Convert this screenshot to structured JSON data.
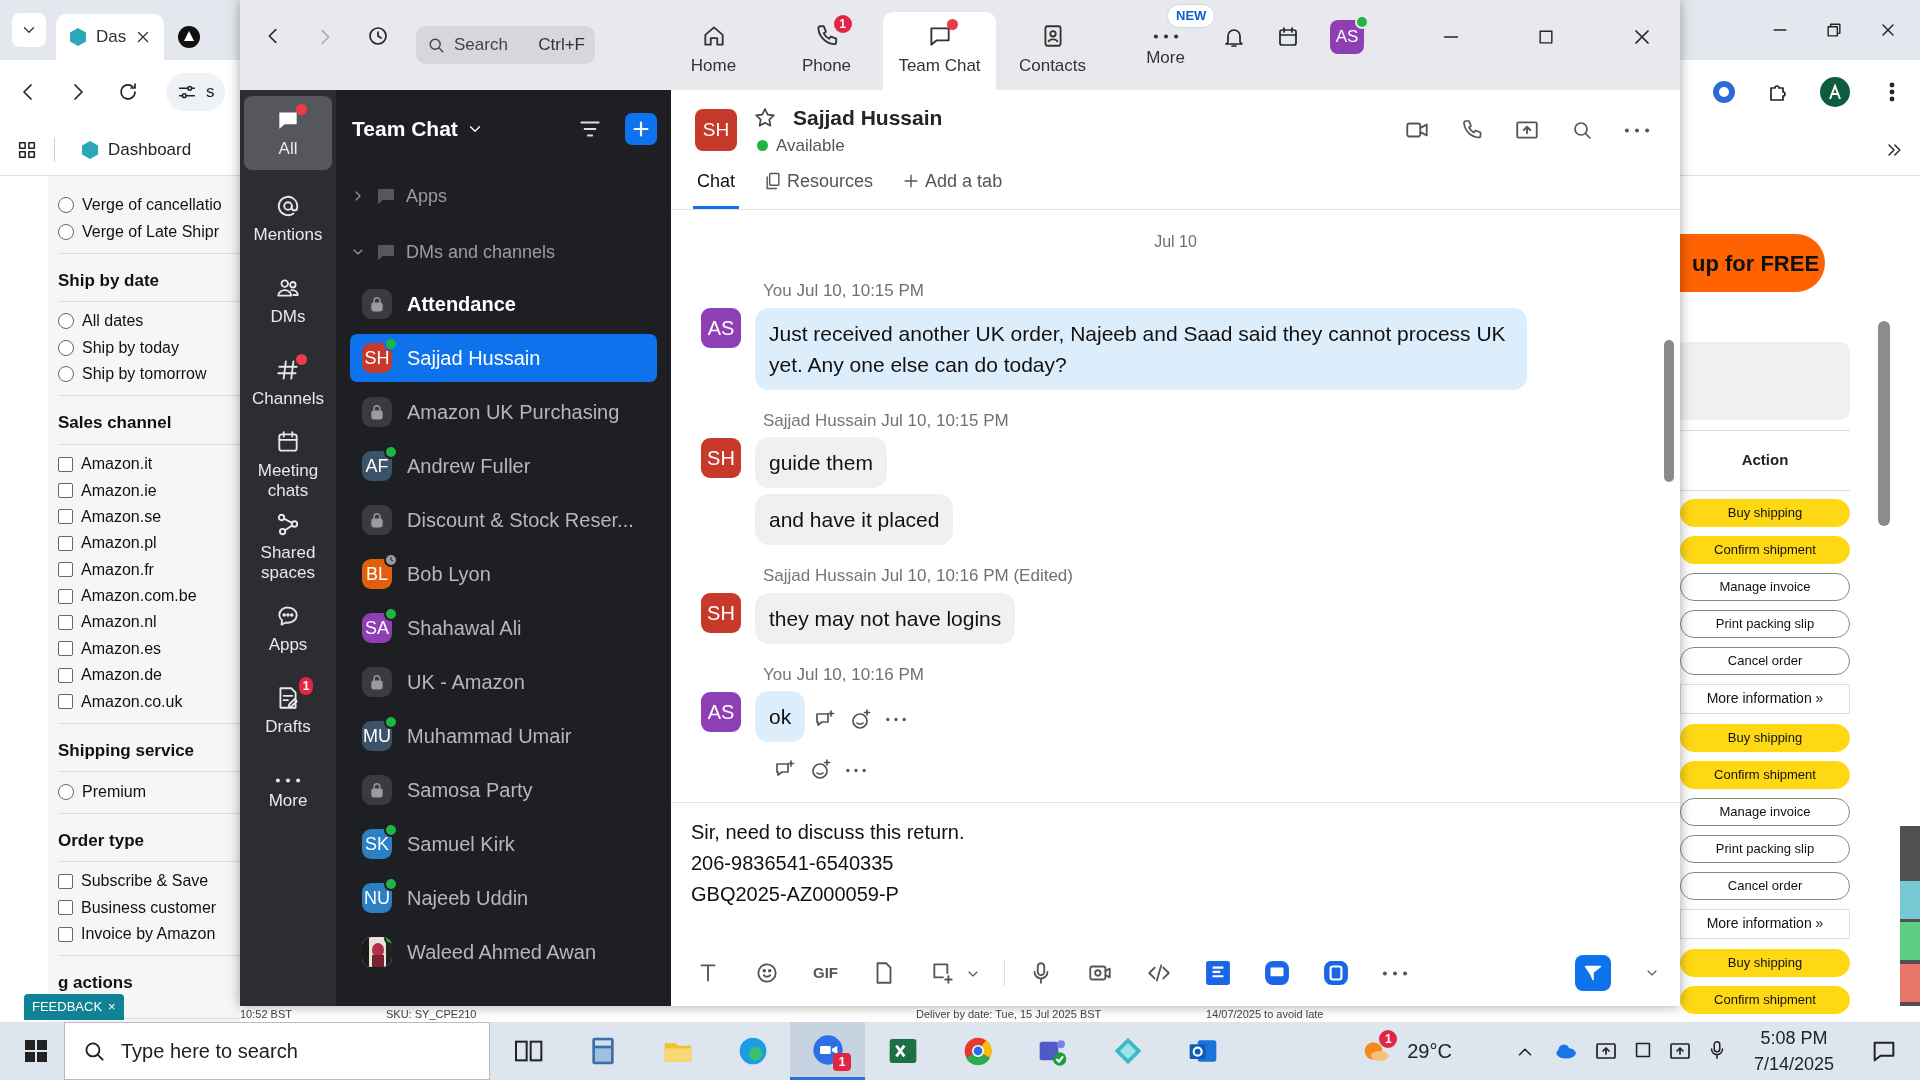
{
  "browser": {
    "tabs": [
      {
        "label": "Das",
        "selected": true
      },
      {
        "selected": false
      }
    ],
    "address": "s",
    "bookmarks": [
      {
        "label": "Dashboard"
      }
    ]
  },
  "filters": [
    {
      "kind": "radio",
      "items": [
        {
          "label": "Verge of cancellatio",
          "checked": false
        },
        {
          "label": "Verge of Late Shipr",
          "checked": false
        }
      ]
    },
    {
      "title": "Ship by date",
      "kind": "radio",
      "items": [
        {
          "label": "All dates",
          "checked": false
        },
        {
          "label": "Ship by today",
          "checked": false
        },
        {
          "label": "Ship by tomorrow",
          "checked": false
        }
      ]
    },
    {
      "title": "Sales channel",
      "kind": "checkbox",
      "items": [
        {
          "label": "Amazon.it",
          "checked": false
        },
        {
          "label": "Amazon.ie",
          "checked": false
        },
        {
          "label": "Amazon.se",
          "checked": false
        },
        {
          "label": "Amazon.pl",
          "checked": false
        },
        {
          "label": "Amazon.fr",
          "checked": false
        },
        {
          "label": "Amazon.com.be",
          "checked": false
        },
        {
          "label": "Amazon.nl",
          "checked": false
        },
        {
          "label": "Amazon.es",
          "checked": false
        },
        {
          "label": "Amazon.de",
          "checked": false
        },
        {
          "label": "Amazon.co.uk",
          "checked": false
        }
      ]
    },
    {
      "title": "Shipping service",
      "kind": "radio",
      "items": [
        {
          "label": "Premium",
          "checked": false
        }
      ]
    },
    {
      "title": "Order type",
      "kind": "checkbox",
      "items": [
        {
          "label": "Subscribe & Save",
          "checked": false
        },
        {
          "label": "Business customer",
          "checked": false
        },
        {
          "label": "Invoice by Amazon",
          "checked": false
        }
      ]
    },
    {
      "title": "g actions",
      "kind": "heading"
    }
  ],
  "feedback": {
    "label": "FEEDBACK",
    "close": "×"
  },
  "promo": {
    "label": "up for FREE"
  },
  "actions_table": {
    "header": "Action",
    "buttons": [
      {
        "label": "Buy shipping",
        "kind": "primary"
      },
      {
        "label": "Confirm shipment",
        "kind": "primary"
      },
      {
        "label": "Manage invoice",
        "kind": "secondary"
      },
      {
        "label": "Print packing slip",
        "kind": "secondary"
      },
      {
        "label": "Cancel order",
        "kind": "secondary"
      },
      {
        "label": "More information »",
        "kind": "more"
      },
      {
        "label": "Buy shipping",
        "kind": "primary"
      },
      {
        "label": "Confirm shipment",
        "kind": "primary"
      },
      {
        "label": "Manage invoice",
        "kind": "secondary"
      },
      {
        "label": "Print packing slip",
        "kind": "secondary"
      },
      {
        "label": "Cancel order",
        "kind": "secondary"
      },
      {
        "label": "More information »",
        "kind": "more"
      },
      {
        "label": "Buy shipping",
        "kind": "primary"
      },
      {
        "label": "Confirm shipment",
        "kind": "primary"
      }
    ]
  },
  "page_row": [
    "10:52 BST",
    "SKU: SY_CPE210",
    "Deliver by date: Tue, 15 Jul 2025 BST",
    "14/07/2025 to avoid late"
  ],
  "zoom": {
    "search": {
      "placeholder": "Search",
      "shortcut": "Ctrl+F"
    },
    "tabs": [
      {
        "label": "Home",
        "kind": "home",
        "selected": false
      },
      {
        "label": "Phone",
        "kind": "phone",
        "selected": false,
        "badge": "1"
      },
      {
        "label": "Team Chat",
        "kind": "chat",
        "selected": true,
        "unread": true
      },
      {
        "label": "Contacts",
        "kind": "contacts",
        "selected": false
      },
      {
        "label": "More",
        "kind": "more",
        "selected": false,
        "tag": "NEW"
      }
    ],
    "user": {
      "initials": "AS",
      "color": "#8e3fb5",
      "online": true
    },
    "rail": [
      {
        "label": "All",
        "kind": "all",
        "selected": true,
        "unread": true
      },
      {
        "label": "Mentions",
        "kind": "mentions",
        "selected": false,
        "unread": false
      },
      {
        "label": "DMs",
        "kind": "dms",
        "selected": false,
        "unread": false
      },
      {
        "label": "Channels",
        "kind": "channels",
        "selected": false,
        "unread": true
      },
      {
        "label": "Meeting chats",
        "kind": "meetings",
        "selected": false,
        "unread": false
      },
      {
        "label": "Shared spaces",
        "kind": "spaces",
        "selected": false,
        "unread": false
      },
      {
        "label": "Apps",
        "kind": "apps",
        "selected": false,
        "unread": false
      },
      {
        "label": "Drafts",
        "kind": "drafts",
        "selected": false,
        "unread": false,
        "badge": "1"
      },
      {
        "label": "More",
        "kind": "more",
        "selected": false,
        "unread": false
      }
    ],
    "list": {
      "title": "Team Chat",
      "sections": [
        {
          "label": "Apps",
          "expanded": false
        },
        {
          "label": "DMs and channels",
          "expanded": true
        }
      ],
      "items": [
        {
          "name": "Attendance",
          "kind": "channel",
          "unread": true,
          "selected": false
        },
        {
          "name": "Sajjad Hussain",
          "kind": "person",
          "initials": "SH",
          "color": "#c7392b",
          "online": true,
          "away": false,
          "unread": false,
          "selected": true
        },
        {
          "name": "Amazon UK Purchasing",
          "kind": "channel",
          "unread": false,
          "selected": false
        },
        {
          "name": "Andrew Fuller",
          "kind": "person",
          "initials": "AF",
          "color": "#3b5369",
          "online": true,
          "away": false,
          "unread": false,
          "selected": false
        },
        {
          "name": "Discount & Stock Reser...",
          "kind": "channel",
          "unread": false,
          "selected": false
        },
        {
          "name": "Bob Lyon",
          "kind": "person",
          "initials": "BL",
          "color": "#e0600e",
          "online": false,
          "away": true,
          "unread": false,
          "selected": false
        },
        {
          "name": "Shahawal Ali",
          "kind": "person",
          "initials": "SA",
          "color": "#8e3fb5",
          "online": true,
          "away": false,
          "unread": false,
          "selected": false
        },
        {
          "name": "UK - Amazon",
          "kind": "channel",
          "unread": false,
          "selected": false
        },
        {
          "name": "Muhammad Umair",
          "kind": "person",
          "initials": "MU",
          "color": "#3b5369",
          "online": true,
          "away": false,
          "unread": false,
          "selected": false
        },
        {
          "name": "Samosa Party",
          "kind": "channel",
          "unread": false,
          "selected": false
        },
        {
          "name": "Samuel Kirk",
          "kind": "person",
          "initials": "SK",
          "color": "#2b7fc3",
          "online": true,
          "away": false,
          "unread": false,
          "selected": false
        },
        {
          "name": "Najeeb Uddin",
          "kind": "person",
          "initials": "NU",
          "color": "#2b7fc3",
          "online": true,
          "away": false,
          "unread": false,
          "selected": false
        },
        {
          "name": "Waleed Ahmed Awan",
          "online": true,
          "away": false,
          "unread": false,
          "selected": false
        }
      ]
    },
    "chat": {
      "initials": "SH",
      "color": "#c7392b",
      "name": "Sajjad Hussain",
      "starred": false,
      "status": "Available",
      "tabs": [
        {
          "label": "Chat",
          "kind": "chat",
          "selected": true
        },
        {
          "label": "Resources",
          "kind": "resources",
          "selected": false
        },
        {
          "label": "Add a tab",
          "kind": "add",
          "selected": false
        }
      ],
      "date": "Jul 10",
      "groups": [
        {
          "sender": "You",
          "time": "Jul 10, 10:15 PM",
          "initials": "AS",
          "color": "#8e3fb5",
          "mine": true,
          "bubbles": [
            "Just received another UK order, Najeeb and Saad said they cannot process UK yet. Any one else can do today?"
          ]
        },
        {
          "sender": "Sajjad Hussain",
          "time": "Jul 10, 10:15 PM",
          "initials": "SH",
          "color": "#c7392b",
          "mine": false,
          "bubbles": [
            "guide them",
            "and have it placed"
          ]
        },
        {
          "sender": "Sajjad Hussain",
          "time": "Jul 10, 10:16 PM",
          "edited": "(Edited)",
          "initials": "SH",
          "color": "#c7392b",
          "mine": false,
          "bubbles": [
            "they may not have logins"
          ]
        },
        {
          "sender": "You",
          "time": "Jul 10, 10:16 PM",
          "initials": "AS",
          "color": "#8e3fb5",
          "mine": true,
          "bubbles": [
            "ok"
          ]
        }
      ],
      "composer": [
        "Sir, need to discuss this return.",
        "206-9836541-6540335",
        "GBQ2025-AZ000059-P"
      ],
      "tools": [
        {
          "kind": "text"
        },
        {
          "kind": "emoji"
        },
        {
          "kind": "gif",
          "label": "GIF"
        },
        {
          "kind": "file"
        },
        {
          "kind": "screenshot"
        },
        {
          "kind": "caret"
        },
        {
          "kind": "mic"
        },
        {
          "kind": "camera"
        },
        {
          "kind": "code"
        },
        {
          "kind": "app-doc"
        },
        {
          "kind": "app-board"
        },
        {
          "kind": "app-clip"
        },
        {
          "kind": "more"
        }
      ]
    }
  },
  "taskbar": {
    "search": {
      "placeholder": "Type here to search"
    },
    "apps": [
      {
        "kind": "taskview",
        "active": false
      },
      {
        "kind": "calculator",
        "active": false
      },
      {
        "kind": "explorer",
        "active": false
      },
      {
        "kind": "edge",
        "active": false
      },
      {
        "kind": "zoom",
        "active": true,
        "badge": "1"
      },
      {
        "kind": "excel",
        "active": false
      },
      {
        "kind": "chrome",
        "active": false
      },
      {
        "kind": "teams",
        "active": false
      },
      {
        "kind": "diamond",
        "active": false
      },
      {
        "kind": "outlook",
        "active": false
      }
    ],
    "weather": {
      "temp": "29°C",
      "badge": "1"
    },
    "time": "5:08 PM",
    "date": "7/14/2025"
  }
}
